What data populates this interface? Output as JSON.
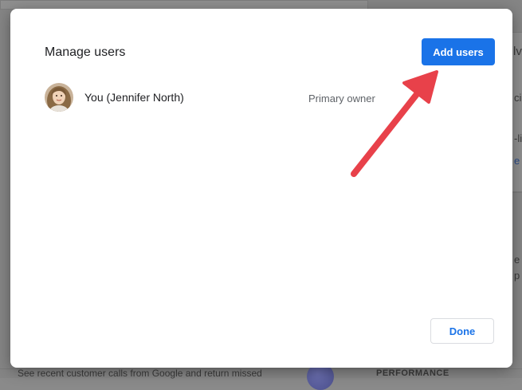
{
  "background": {
    "snippets": [
      "lve",
      "ci",
      "-liv",
      "e H",
      "e",
      "p",
      "PERFORMANCE",
      "See recent customer calls from Google and return missed"
    ]
  },
  "dialog": {
    "title": "Manage users",
    "add_button": "Add users",
    "users": [
      {
        "name": "You (Jennifer North)",
        "role": "Primary owner"
      }
    ],
    "done_button": "Done"
  },
  "annotation": {
    "arrow_color": "#e8414a"
  },
  "colors": {
    "accent": "#1a73e8"
  }
}
